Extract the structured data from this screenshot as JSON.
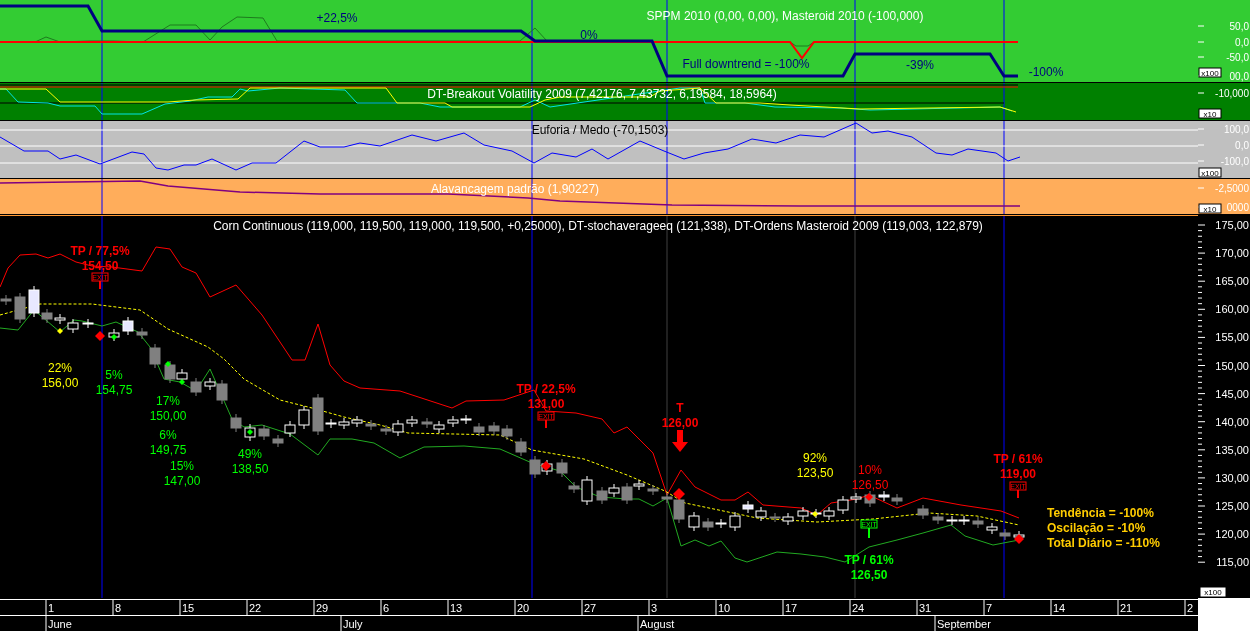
{
  "panels": [
    {
      "kind": "sppm",
      "title": "SPPM 2010 (0,00, 0,00), Masteroid 2010 (-100,000)",
      "labels": [
        "+22,5%",
        "0%",
        "Full downtrend = -100%",
        "-39%",
        "-100%"
      ],
      "axis": [
        "50,0",
        "0,0",
        "-50,0",
        "00,0"
      ],
      "scale": "x100"
    },
    {
      "kind": "breakout",
      "title": "DT-Breakout Volatility 2009 (7,42176, 7,43732, 6,19584, 18,5964)",
      "axis": [
        "-10,000"
      ],
      "scale": "x10"
    },
    {
      "kind": "euforia",
      "title": "Euforia / Medo (-70,1503)",
      "axis": [
        "100,0",
        "0,0",
        "-100,0"
      ],
      "scale": "x100"
    },
    {
      "kind": "alavancagem",
      "title": "Alavancagem padrão (1,90227)",
      "axis": [
        "-2,5000",
        "0000"
      ],
      "scale": "x10"
    }
  ],
  "main": {
    "title": "Corn Continuous (119,000, 119,500, 119,000, 119,500, +0,25000), DT-stochaverageeq (121,338), DT-Ordens Masteroid 2009 (119,003, 122,879)",
    "annotations": [
      {
        "kind": "target",
        "lines": [
          "TP / 77,5%",
          "154,50"
        ],
        "color": "#ff0000",
        "marker": "EXIT"
      },
      {
        "kind": "signal",
        "lines": [
          "22%",
          "156,00"
        ],
        "color": "#ffff00"
      },
      {
        "kind": "signal",
        "lines": [
          "5%",
          "154,75"
        ],
        "color": "#00ff00"
      },
      {
        "kind": "signal",
        "lines": [
          "17%",
          "150,00"
        ],
        "color": "#00ff00"
      },
      {
        "kind": "signal",
        "lines": [
          "6%",
          "149,75"
        ],
        "color": "#00ff00"
      },
      {
        "kind": "signal",
        "lines": [
          "15%",
          "147,00"
        ],
        "color": "#00ff00"
      },
      {
        "kind": "signal",
        "lines": [
          "49%",
          "138,50"
        ],
        "color": "#00ff00"
      },
      {
        "kind": "target",
        "lines": [
          "TP / 22,5%",
          "131,00"
        ],
        "color": "#ff0000",
        "marker": "EXIT"
      },
      {
        "kind": "entry",
        "lines": [
          "T",
          "126,00"
        ],
        "color": "#ff0000"
      },
      {
        "kind": "signal",
        "lines": [
          "92%",
          "123,50"
        ],
        "color": "#ffff00"
      },
      {
        "kind": "signal",
        "lines": [
          "10%",
          "126,50"
        ],
        "color": "#ff0000"
      },
      {
        "kind": "target",
        "lines": [
          "TP / 61%",
          "119,00"
        ],
        "color": "#ff0000",
        "marker": "EXIT"
      },
      {
        "kind": "target",
        "lines": [
          "TP / 61%",
          "126,50"
        ],
        "color": "#00ff00",
        "marker": "EXIT"
      }
    ],
    "summary": [
      "Tendência = -100%",
      "Oscilação = -10%",
      "Total Diário = -110%"
    ],
    "axis": [
      "175,00",
      "170,00",
      "165,00",
      "160,00",
      "155,00",
      "150,00",
      "145,00",
      "140,00",
      "135,00",
      "130,00",
      "125,00",
      "120,00",
      "115,00"
    ],
    "scale": "x100"
  },
  "date_axis": {
    "days": [
      "1",
      "8",
      "15",
      "22",
      "29",
      "6",
      "13",
      "20",
      "27",
      "3",
      "10",
      "17",
      "24",
      "31",
      "7",
      "14",
      "21",
      "2"
    ],
    "months": [
      "June",
      "July",
      "August",
      "September"
    ]
  }
}
